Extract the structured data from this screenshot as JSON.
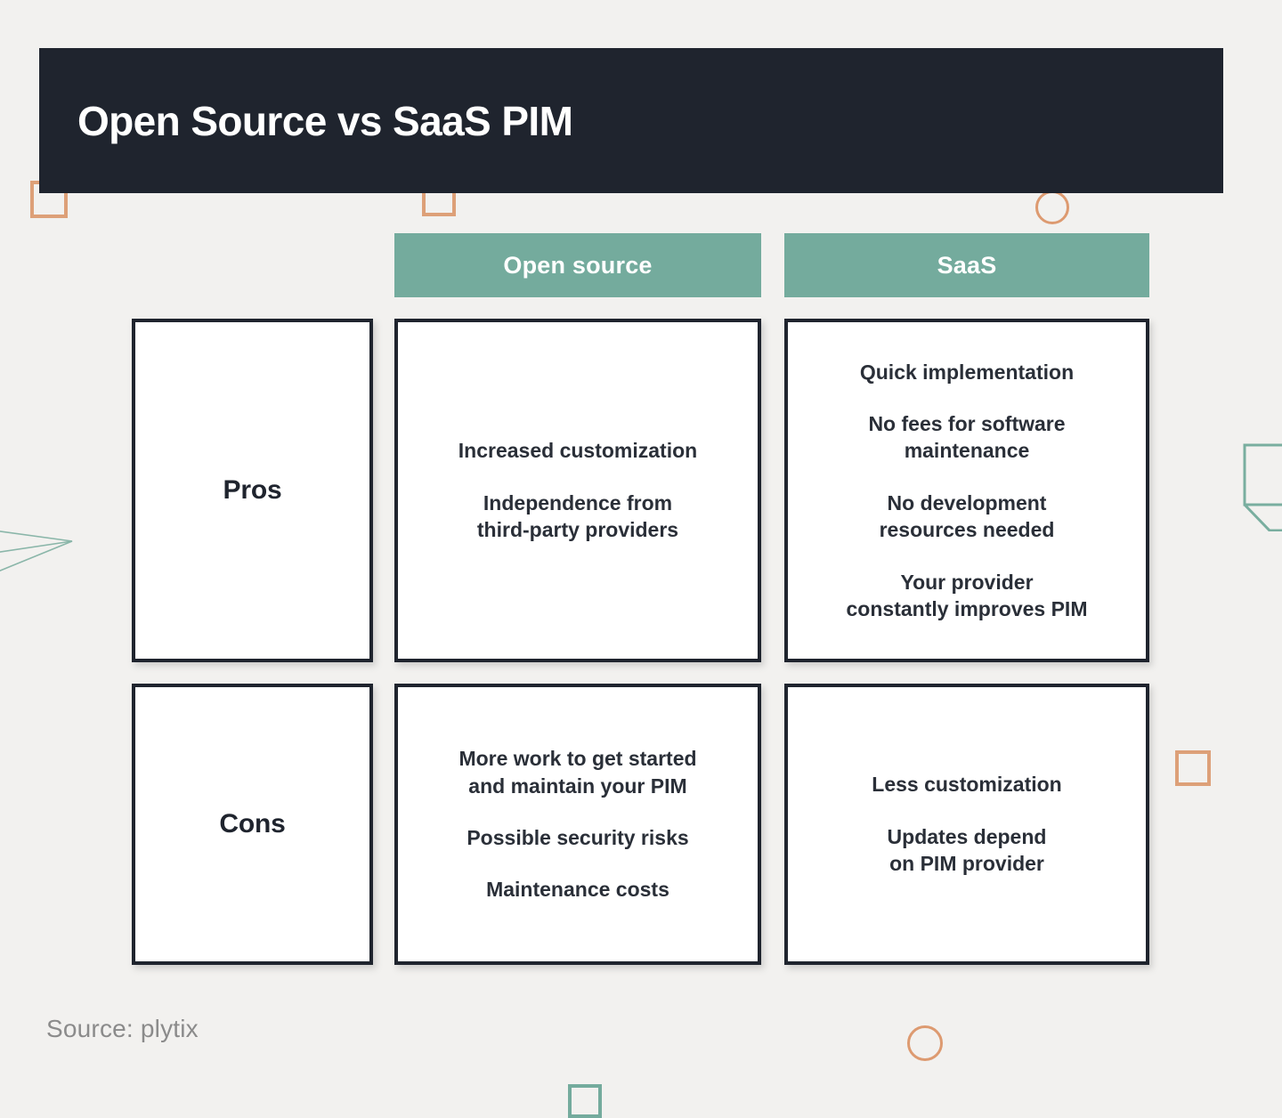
{
  "header": {
    "title": "Open Source vs SaaS PIM",
    "background_color": "#1f242e",
    "text_color": "#ffffff"
  },
  "theme": {
    "background_color": "#f2f1ef",
    "accent_green": "#74ab9d",
    "accent_orange": "#dda078",
    "dark": "#1f242e",
    "cell_background": "#ffffff",
    "muted_text": "#8b8b8b"
  },
  "table": {
    "column_headers": [
      {
        "label": "Open source"
      },
      {
        "label": "SaaS"
      }
    ],
    "rows": [
      {
        "label": "Pros",
        "cells": [
          {
            "column": "Open source",
            "items": [
              "Increased customization",
              "Independence from\nthird-party providers"
            ]
          },
          {
            "column": "SaaS",
            "items": [
              "Quick implementation",
              "No fees for software\nmaintenance",
              "No development\nresources needed",
              "Your provider\nconstantly improves PIM"
            ]
          }
        ]
      },
      {
        "label": "Cons",
        "cells": [
          {
            "column": "Open source",
            "items": [
              "More work to get started\nand maintain your PIM",
              "Possible security risks",
              "Maintenance costs"
            ]
          },
          {
            "column": "SaaS",
            "items": [
              "Less customization",
              "Updates depend\non PIM provider"
            ]
          }
        ]
      }
    ]
  },
  "footer": {
    "source": "Source: plytix"
  },
  "decorations": [
    {
      "name": "square-outline-top-left",
      "shape": "square",
      "color": "#dda078"
    },
    {
      "name": "square-outline-top-middle",
      "shape": "square",
      "color": "#dda078"
    },
    {
      "name": "circle-outline-top-right",
      "shape": "circle",
      "color": "#dd9a70"
    },
    {
      "name": "paper-plane-outline-left",
      "shape": "polyline",
      "color": "#74ab9d"
    },
    {
      "name": "tag-outline-right",
      "shape": "polyline",
      "color": "#74ab9d"
    },
    {
      "name": "square-outline-right",
      "shape": "square",
      "color": "#dda078"
    },
    {
      "name": "circle-outline-bottom",
      "shape": "circle",
      "color": "#dd9a70"
    },
    {
      "name": "square-outline-bottom",
      "shape": "square",
      "color": "#74ab9d"
    }
  ]
}
